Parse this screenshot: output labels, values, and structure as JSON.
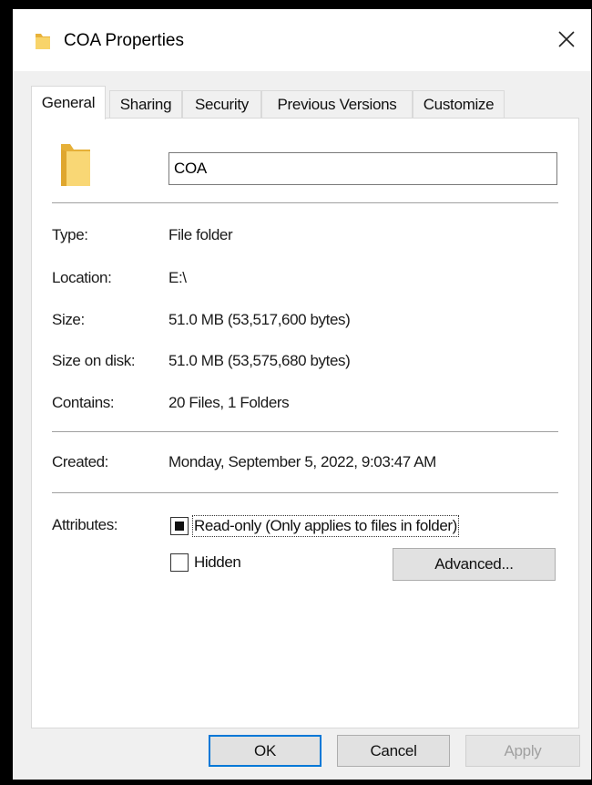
{
  "window": {
    "title": "COA Properties",
    "close_icon": "close-icon"
  },
  "tabs": [
    {
      "label": "General",
      "active": true
    },
    {
      "label": "Sharing",
      "active": false
    },
    {
      "label": "Security",
      "active": false
    },
    {
      "label": "Previous Versions",
      "active": false
    },
    {
      "label": "Customize",
      "active": false
    }
  ],
  "general": {
    "folder_icon": "folder-icon",
    "folder_name": "COA",
    "properties": [
      {
        "label": "Type:",
        "value": "File folder"
      },
      {
        "label": "Location:",
        "value": "E:\\"
      },
      {
        "label": "Size:",
        "value": "51.0 MB (53,517,600 bytes)"
      },
      {
        "label": "Size on disk:",
        "value": "51.0 MB (53,575,680 bytes)"
      },
      {
        "label": "Contains:",
        "value": "20 Files, 1 Folders"
      }
    ],
    "created": {
      "label": "Created:",
      "value": "Monday, September 5, 2022, 9:03:47 AM"
    },
    "attributes": {
      "label": "Attributes:",
      "readonly_label": "Read-only (Only applies to files in folder)",
      "readonly_state": "indeterminate",
      "hidden_label": "Hidden",
      "hidden_checked": false,
      "advanced_label": "Advanced..."
    }
  },
  "buttons": {
    "ok": "OK",
    "cancel": "Cancel",
    "apply": "Apply"
  },
  "colors": {
    "folder": "#f5c451",
    "default_button_border": "#0078d7"
  }
}
